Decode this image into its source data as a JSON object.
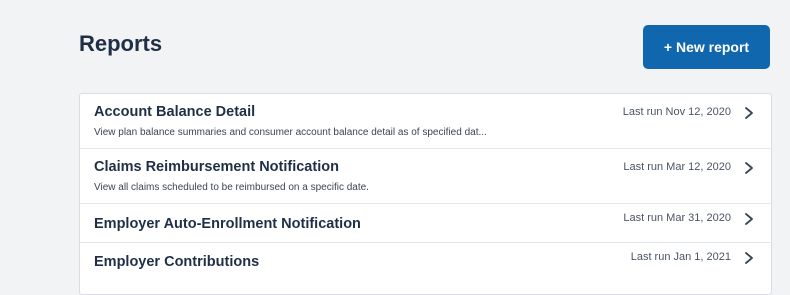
{
  "header": {
    "title": "Reports",
    "new_report_label": "+ New report"
  },
  "reports": [
    {
      "title": "Account Balance Detail",
      "description": "View plan balance summaries and consumer account balance detail as of specified dat...",
      "last_run": "Last run Nov 12, 2020"
    },
    {
      "title": "Claims Reimbursement Notification",
      "description": "View all claims scheduled to be reimbursed on a specific date.",
      "last_run": "Last run Mar 12, 2020"
    },
    {
      "title": "Employer Auto-Enrollment Notification",
      "description": "",
      "last_run": "Last run Mar 31, 2020"
    },
    {
      "title": "Employer Contributions",
      "description": "",
      "last_run": "Last run Jan 1, 2021"
    }
  ],
  "icons": {
    "row_arrow": "chevron-right-icon"
  },
  "colors": {
    "accent": "#1167ad",
    "title_text": "#1f2f46",
    "background": "#f2f3f5"
  }
}
